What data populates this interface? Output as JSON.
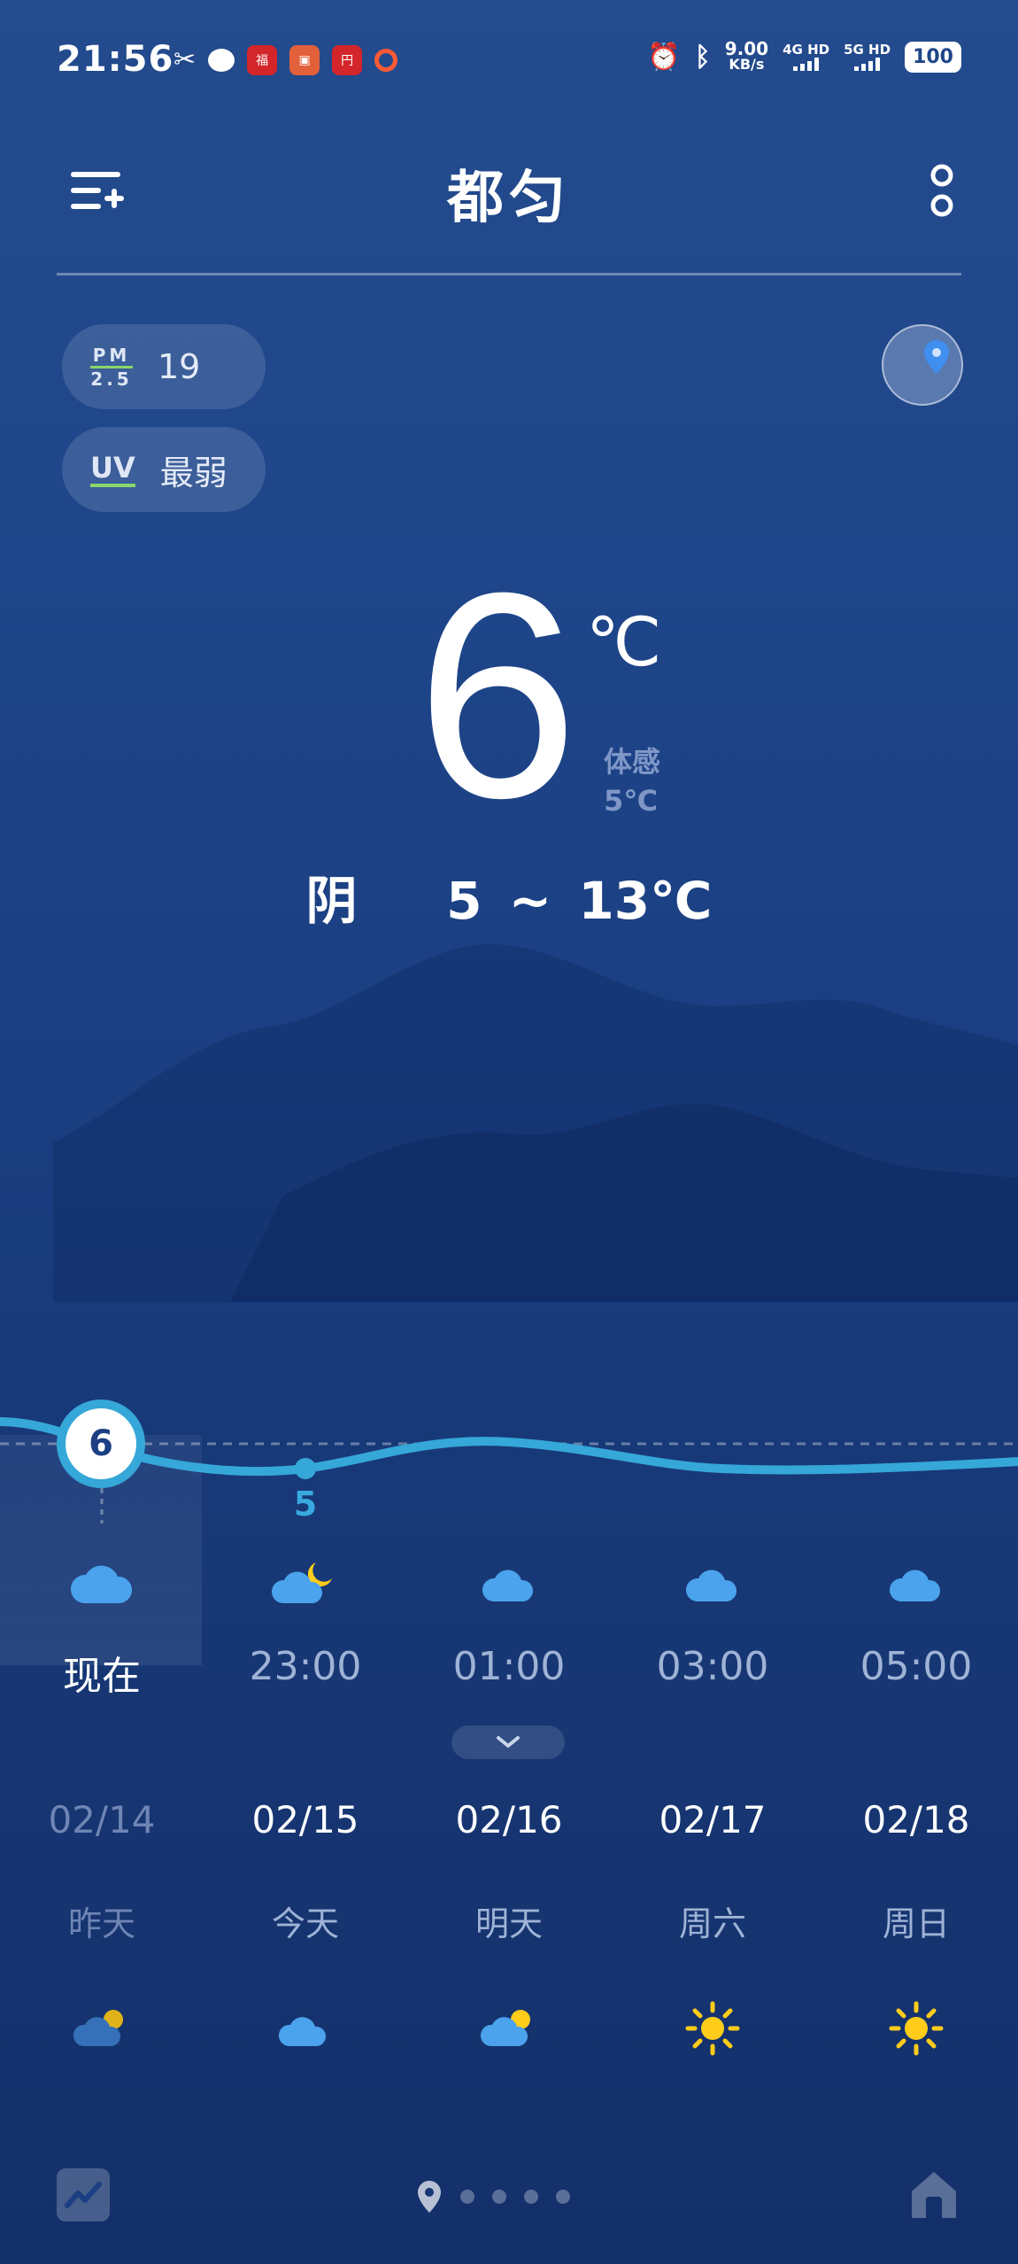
{
  "status": {
    "time": "21:56",
    "net_speed": "9.00",
    "net_unit": "KB/s",
    "sim1": "4G HD",
    "sim2": "5G HD",
    "battery": "100"
  },
  "header": {
    "city": "都匀"
  },
  "pills": {
    "pm_icon_top": "PM",
    "pm_icon_bottom": "2.5",
    "pm_value": "19",
    "uv_icon": "UV",
    "uv_value": "最弱"
  },
  "current": {
    "temp": "6",
    "unit": "℃",
    "feel_label": "体感",
    "feel_value": "5℃",
    "condition": "阴",
    "range": "5 ~ 13℃"
  },
  "hourly": {
    "now_temp": "6",
    "next_temp": "5",
    "items": [
      {
        "label": "现在",
        "icon": "cloud-icon"
      },
      {
        "label": "23:00",
        "icon": "cloud-moon-icon"
      },
      {
        "label": "01:00",
        "icon": "cloud-icon"
      },
      {
        "label": "03:00",
        "icon": "cloud-icon"
      },
      {
        "label": "05:00",
        "icon": "cloud-icon"
      }
    ]
  },
  "daily": [
    {
      "date": "02/14",
      "name": "昨天",
      "icon": "partly-cloudy-icon"
    },
    {
      "date": "02/15",
      "name": "今天",
      "icon": "cloud-icon"
    },
    {
      "date": "02/16",
      "name": "明天",
      "icon": "partly-cloudy-icon"
    },
    {
      "date": "02/17",
      "name": "周六",
      "icon": "sun-icon"
    },
    {
      "date": "02/18",
      "name": "周日",
      "icon": "sun-icon"
    }
  ],
  "colors": {
    "accent_curve": "#35a7d8",
    "sun": "#ffcc1a",
    "pill_line": "#8bd76a"
  }
}
